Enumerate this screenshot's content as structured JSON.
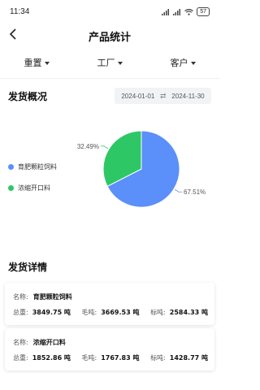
{
  "status": {
    "time": "11:34",
    "battery": "57"
  },
  "nav": {
    "title": "产品统计"
  },
  "filters": [
    {
      "label": "重置"
    },
    {
      "label": "工厂"
    },
    {
      "label": "客户"
    }
  ],
  "overview": {
    "title": "发货概况",
    "date_start": "2024-01-01",
    "date_sep": "⇄",
    "date_end": "2024-11-30"
  },
  "chart_data": {
    "type": "pie",
    "title": "",
    "slices": [
      {
        "name": "育肥颗粒饲料",
        "value": 67.51,
        "label": "67.51%",
        "color": "#5b8ff9"
      },
      {
        "name": "浓缩开口料",
        "value": 32.49,
        "label": "32.49%",
        "color": "#2ec766"
      }
    ],
    "legend_position": "left"
  },
  "details": {
    "title": "发货详情",
    "name_label": "名称:",
    "gross_label": "总重:",
    "net_label": "毛吨:",
    "std_label": "标吨:",
    "items": [
      {
        "name": "育肥颗粒饲料",
        "gross": "3849.75 吨",
        "net": "3669.53 吨",
        "std": "2584.33 吨"
      },
      {
        "name": "浓缩开口料",
        "gross": "1852.86 吨",
        "net": "1767.83 吨",
        "std": "1428.77 吨"
      }
    ]
  }
}
